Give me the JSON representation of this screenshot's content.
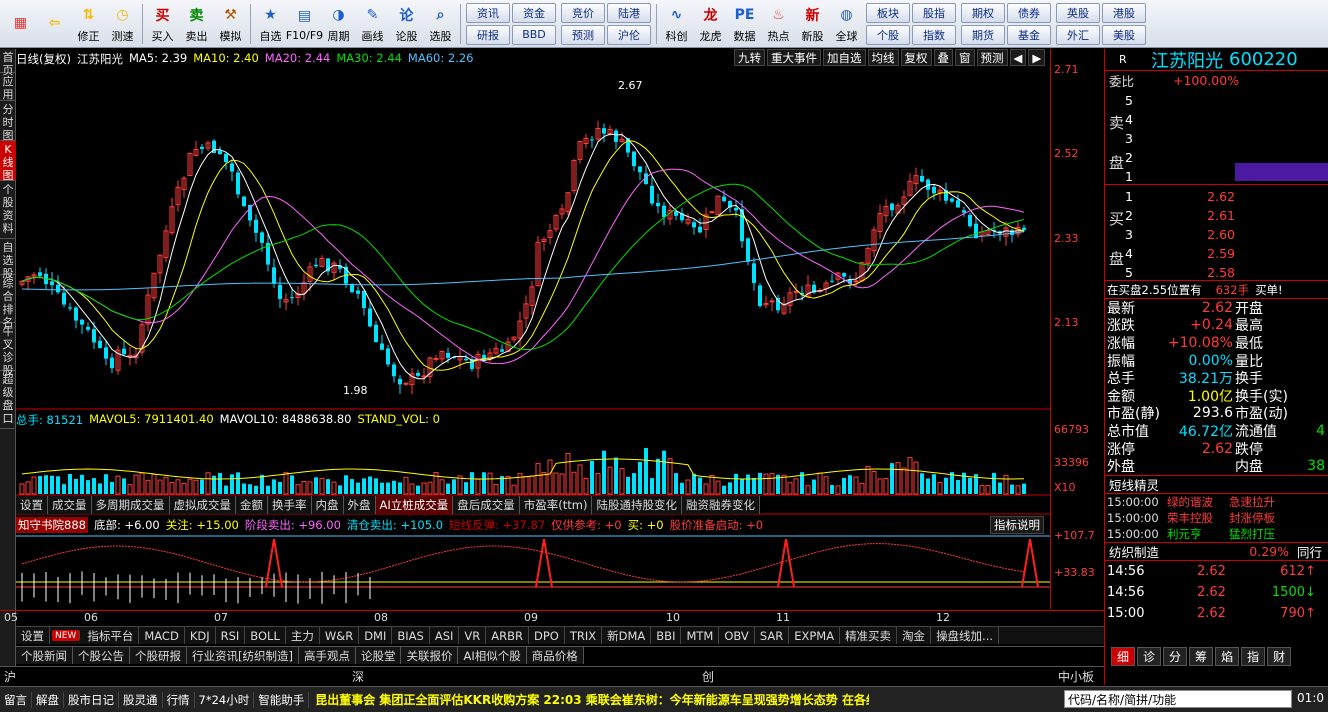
{
  "toolbar": {
    "items": [
      {
        "label": "",
        "icon": "grid-icon"
      },
      {
        "label": "",
        "icon": "back-arrow-icon"
      },
      {
        "label": "修正",
        "icon": "up-down-arrow-icon"
      },
      {
        "label": "测速",
        "icon": "clock-icon"
      },
      {
        "label": "买入",
        "icon": "buy-icon"
      },
      {
        "label": "卖出",
        "icon": "sell-icon"
      },
      {
        "label": "模拟",
        "icon": "hammer-icon"
      },
      {
        "label": "自选",
        "icon": "star-icon"
      },
      {
        "label": "F10/F9",
        "icon": "f10-icon"
      },
      {
        "label": "周期",
        "icon": "cycle-icon"
      },
      {
        "label": "画线",
        "icon": "pen-icon"
      },
      {
        "label": "论股",
        "icon": "talk-icon"
      },
      {
        "label": "选股",
        "icon": "magnifier-icon"
      }
    ],
    "group1": [
      "资讯",
      "资金",
      "研报",
      "BBD"
    ],
    "group2": [
      "竞价",
      "陆港",
      "预测",
      "沪伦"
    ],
    "items2": [
      {
        "label": "科创",
        "icon": "chart-icon"
      },
      {
        "label": "龙虎",
        "icon": "dragon-icon"
      },
      {
        "label": "数据",
        "icon": "pe-icon"
      },
      {
        "label": "热点",
        "icon": "hot-icon"
      },
      {
        "label": "新股",
        "icon": "newstock-icon"
      },
      {
        "label": "全球",
        "icon": "globe-icon"
      }
    ],
    "group3": [
      "板块",
      "股指",
      "个股",
      "指数"
    ],
    "group4": [
      "期权",
      "债券",
      "期货",
      "基金"
    ],
    "group5": [
      "英股",
      "港股",
      "外汇",
      "美股"
    ]
  },
  "leftbar": [
    "首页",
    "应用",
    "分时图",
    "K线图",
    "个股资料",
    "自选股",
    "综合排名",
    "牛叉诊股",
    "超级盘口"
  ],
  "header": {
    "period": "日线(复权)",
    "stock": "江苏阳光",
    "ma5": "MA5: 2.39",
    "ma10": "MA10: 2.40",
    "ma20": "MA20: 2.44",
    "ma30": "MA30: 2.44",
    "ma60": "MA60: 2.26"
  },
  "chart_buttons": [
    "九转",
    "重大事件",
    "加自选",
    "均线",
    "复权",
    "叠",
    "窗",
    "预测"
  ],
  "price_axis": {
    "ticks": [
      "2.71",
      "2.52",
      "2.33",
      "2.13"
    ],
    "vol_ticks": [
      "66793",
      "33396",
      "X10"
    ],
    "ind_ticks": [
      "+107.7",
      "+33.83"
    ]
  },
  "annotations": {
    "high": "2.67",
    "low": "1.98"
  },
  "volume_info": {
    "total": "总手: 81521",
    "mavol5": "MAVOL5: 7911401.40",
    "mavol10": "MAVOL10: 8488638.80",
    "stand": "STAND_VOL: 0"
  },
  "tabs1": [
    "设置",
    "成交量",
    "多周期成交量",
    "虚拟成交量",
    "金额",
    "换手率",
    "内盘",
    "外盘",
    "AI立桩成交量",
    "盘后成交量",
    "市盈率(ttm)",
    "陆股通持股变化",
    "融资融券变化"
  ],
  "indicator_info": {
    "name": "知守书院888",
    "a": "底部: +6.00",
    "b": "关注: +15.00",
    "c": "阶段卖出: +96.00",
    "d": "清仓卖出: +105.0",
    "e": "短线反弹: +37.87",
    "f": "仅供参考: +0",
    "g": "买: +0",
    "h": "股价准备启动: +0",
    "btn": "指标说明"
  },
  "dates": [
    "05",
    "06",
    "07",
    "08",
    "09",
    "10",
    "11",
    "12"
  ],
  "indbar": [
    "设置",
    "NEW",
    "指标平台",
    "MACD",
    "KDJ",
    "RSI",
    "BOLL",
    "主力",
    "W&R",
    "DMI",
    "BIAS",
    "ASI",
    "VR",
    "ARBR",
    "DPO",
    "TRIX",
    "新DMA",
    "BBI",
    "MTM",
    "OBV",
    "SAR",
    "EXPMA",
    "精准买卖",
    "淘金",
    "操盘线加..."
  ],
  "newsbar": [
    "个股新闻",
    "个股公告",
    "个股研报",
    "行业资讯[纺织制造]",
    "高手观点",
    "论股堂",
    "关联报价",
    "AI相似个股",
    "商品价格"
  ],
  "idxbar": [
    "沪",
    "深",
    "创",
    "中小板指"
  ],
  "bottom": {
    "items": [
      "留言",
      "解盘",
      "股市日记",
      "股灵通",
      "行情",
      "7*24小时",
      "智能助手"
    ],
    "ticker": "昆出董事会 集团正全面评估KKR收购方案       22:03 乘联会崔东树：今年新能源车呈现强势增长态势 在各细分市场均表现良好",
    "search_placeholder": "代码/名称/简拼/功能",
    "clock": "01:0"
  },
  "right": {
    "name": "江苏阳光",
    "code": "600220",
    "weibi_label": "委比",
    "weibi": "+100.00%",
    "sell_label": "卖盘",
    "buy_label": "买盘",
    "sell": [
      {
        "n": "5",
        "p": "",
        "v": ""
      },
      {
        "n": "4",
        "p": "",
        "v": ""
      },
      {
        "n": "3",
        "p": "",
        "v": ""
      },
      {
        "n": "2",
        "p": "",
        "v": ""
      },
      {
        "n": "1",
        "p": "",
        "v": ""
      }
    ],
    "buy": [
      {
        "n": "1",
        "p": "2.62"
      },
      {
        "n": "2",
        "p": "2.61"
      },
      {
        "n": "3",
        "p": "2.60"
      },
      {
        "n": "4",
        "p": "2.59"
      },
      {
        "n": "5",
        "p": "2.58"
      }
    ],
    "inbuy": "在买盘2.55位置有",
    "inbuy_v": "632手",
    "inbuy_btn": "买单!",
    "quotes": [
      [
        "最新",
        "2.62",
        "开盘",
        ""
      ],
      [
        "涨跌",
        "+0.24",
        "最高",
        ""
      ],
      [
        "涨幅",
        "+10.08%",
        "最低",
        ""
      ],
      [
        "振幅",
        "0.00%",
        "量比",
        ""
      ],
      [
        "总手",
        "38.21万",
        "换手",
        ""
      ],
      [
        "金额",
        "1.00亿",
        "换手(实)",
        ""
      ],
      [
        "市盈(静)",
        "293.6",
        "市盈(动)",
        ""
      ],
      [
        "总市值",
        "46.72亿",
        "流通值",
        "4"
      ],
      [
        "涨停",
        "2.62",
        "跌停",
        ""
      ],
      [
        "外盘",
        "",
        "内盘",
        "38"
      ]
    ],
    "short_title": "短线精灵",
    "short": [
      [
        "15:00:00",
        "绿的谐波",
        "急速拉升"
      ],
      [
        "15:00:00",
        "荣丰控股",
        "封涨停板"
      ],
      [
        "15:00:00",
        "利元亨",
        "猛烈打压"
      ]
    ],
    "industry": "纺织制造",
    "industry_pct": "0.29%",
    "industry_btn": "同行",
    "ticks": [
      [
        "14:56",
        "2.62",
        "612"
      ],
      [
        "14:56",
        "2.62",
        "1500"
      ],
      [
        "15:00",
        "2.62",
        "790"
      ]
    ],
    "btabs": [
      "细",
      "诊",
      "分",
      "筹",
      "焰",
      "指",
      "财"
    ]
  }
}
